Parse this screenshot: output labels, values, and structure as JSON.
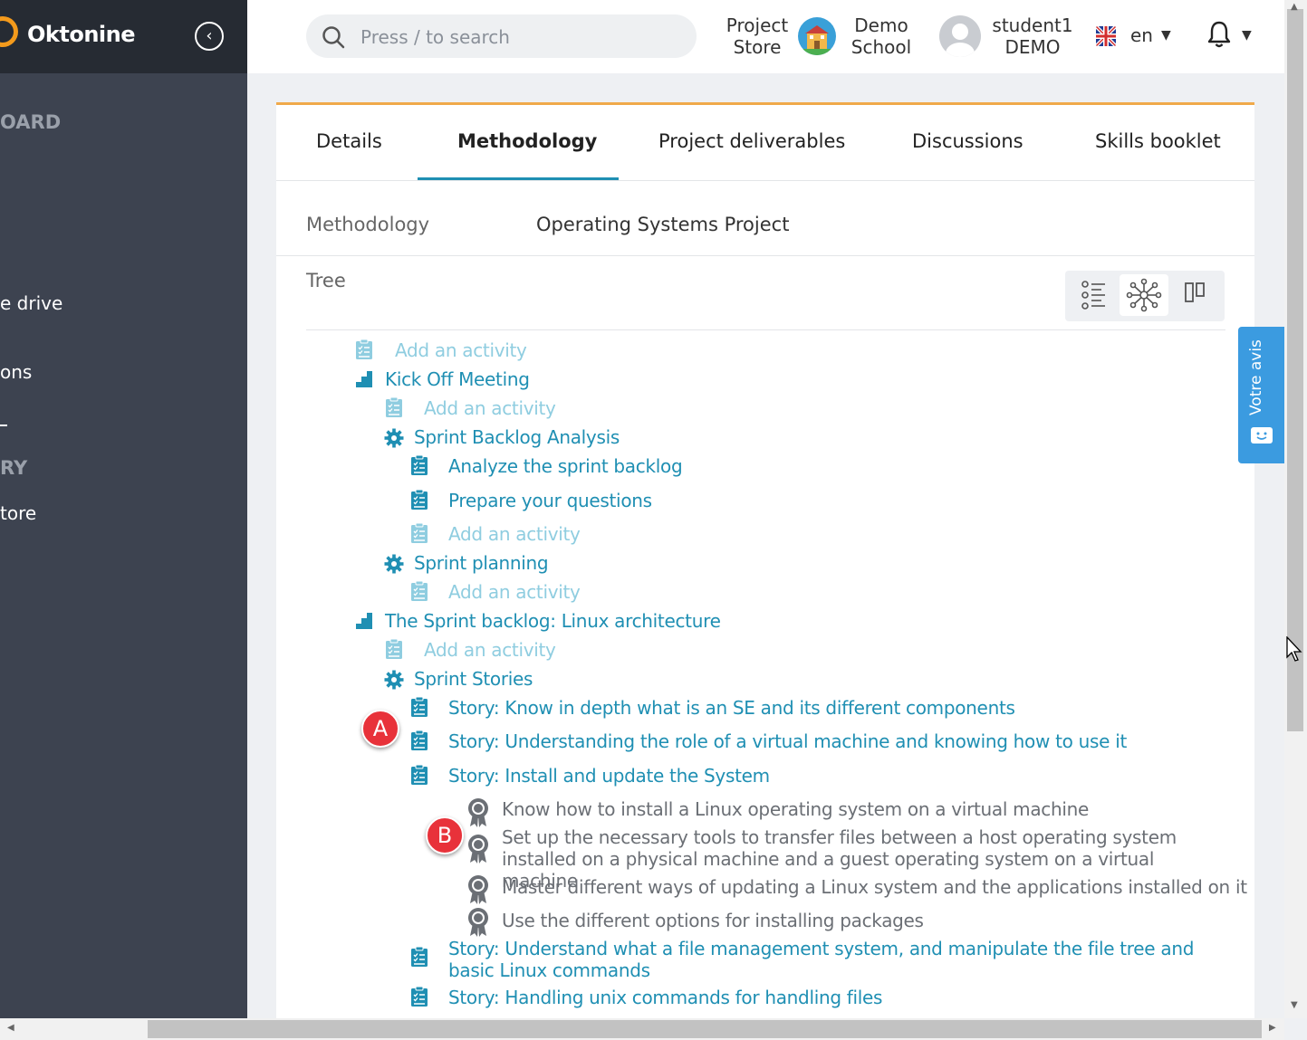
{
  "sidebar": {
    "logo": "Oktonine",
    "collapse_icon": "chevron-left-icon",
    "items": [
      {
        "label": "OARD",
        "kind": "head"
      },
      {
        "label": "e drive",
        "kind": "item"
      },
      {
        "label": "ons",
        "kind": "item"
      },
      {
        "label": "RY",
        "kind": "head"
      },
      {
        "label": "tore",
        "kind": "item"
      }
    ]
  },
  "header": {
    "search_placeholder": "Press / to search",
    "project_store_line1": "Project",
    "project_store_line2": "Store",
    "school_line1": "Demo",
    "school_line2": "School",
    "user_line1": "student1",
    "user_line2": "DEMO",
    "language": "en"
  },
  "tabs": [
    {
      "label": "Details"
    },
    {
      "label": "Methodology",
      "active": true
    },
    {
      "label": "Project deliverables"
    },
    {
      "label": "Discussions"
    },
    {
      "label": "Skills booklet"
    }
  ],
  "methodology": {
    "label": "Methodology",
    "value": "Operating Systems Project"
  },
  "tree": {
    "label": "Tree",
    "views": [
      "list-view-icon",
      "graph-view-icon",
      "columns-view-icon"
    ],
    "nodes": [
      {
        "type": "add",
        "label": "Add an activity"
      },
      {
        "type": "phase",
        "label": "Kick Off Meeting"
      },
      {
        "type": "add",
        "label": "Add an activity"
      },
      {
        "type": "step",
        "label": "Sprint Backlog Analysis"
      },
      {
        "type": "activity",
        "label": "Analyze the sprint backlog"
      },
      {
        "type": "activity",
        "label": "Prepare your questions"
      },
      {
        "type": "add",
        "label": "Add an activity"
      },
      {
        "type": "step",
        "label": "Sprint planning"
      },
      {
        "type": "add",
        "label": "Add an activity"
      },
      {
        "type": "phase",
        "label": "The Sprint backlog: Linux architecture"
      },
      {
        "type": "add",
        "label": "Add an activity"
      },
      {
        "type": "step",
        "label": "Sprint Stories"
      },
      {
        "type": "activity",
        "label": "Story: Know in depth what is an SE and its different components"
      },
      {
        "type": "activity",
        "label": "Story: Understanding the role of a virtual machine and knowing how to use it"
      },
      {
        "type": "activity",
        "label": "Story: Install and update the System"
      },
      {
        "type": "skill",
        "label": "Know how to install a Linux operating system on a virtual machine"
      },
      {
        "type": "skill",
        "label": "Set up the necessary tools to transfer files between a host operating system installed on a physical machine and a guest operating system on a virtual machine"
      },
      {
        "type": "skill",
        "label": "Master different ways of updating a Linux system and the applications installed on it"
      },
      {
        "type": "skill",
        "label": "Use the different options for installing packages"
      },
      {
        "type": "activity",
        "label": "Story: Understand what a file management system, and manipulate the file tree and basic Linux commands"
      },
      {
        "type": "activity",
        "label": "Story: Handling unix commands for handling files"
      }
    ]
  },
  "markers": [
    "A",
    "B"
  ],
  "feedback": {
    "label": "Votre avis"
  },
  "colors": {
    "accent": "#1f8fb3",
    "faded": "#8fcde0",
    "sidebar": "#3d4350",
    "tab_top_border": "#f0a94a",
    "marker": "#e8323a",
    "feedback": "#3b9be0"
  }
}
